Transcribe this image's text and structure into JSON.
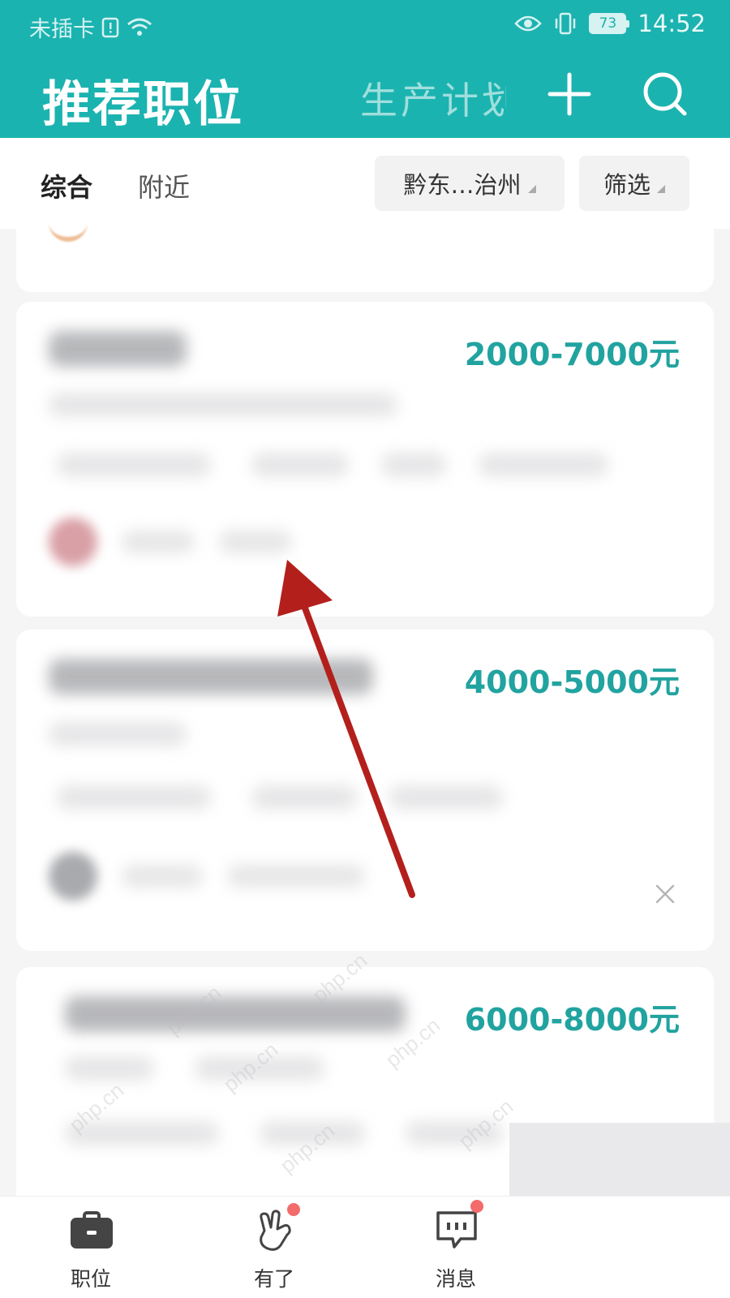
{
  "status_bar": {
    "carrier": "未插卡",
    "battery": "73",
    "time": "14:52"
  },
  "header": {
    "title": "推荐职位",
    "tab": "生产计划"
  },
  "filters": {
    "sort_active": "综合",
    "sort_other": "附近",
    "region": "黔东…治州",
    "filter": "筛选"
  },
  "jobs": [
    {
      "salary": "2000-7000元"
    },
    {
      "salary": "4000-5000元"
    },
    {
      "salary": "6000-8000元"
    }
  ],
  "watermark": "php.cn",
  "bottom_nav": [
    {
      "label": "职位",
      "icon": "briefcase-icon",
      "badge": false
    },
    {
      "label": "有了",
      "icon": "hand-gesture-icon",
      "badge": true
    },
    {
      "label": "消息",
      "icon": "chat-bubble-icon",
      "badge": true
    }
  ],
  "colors": {
    "brand": "#1bb3b0",
    "salary": "#21a3a0",
    "badge": "#f46b6b",
    "annotation_arrow": "#b3201c"
  }
}
